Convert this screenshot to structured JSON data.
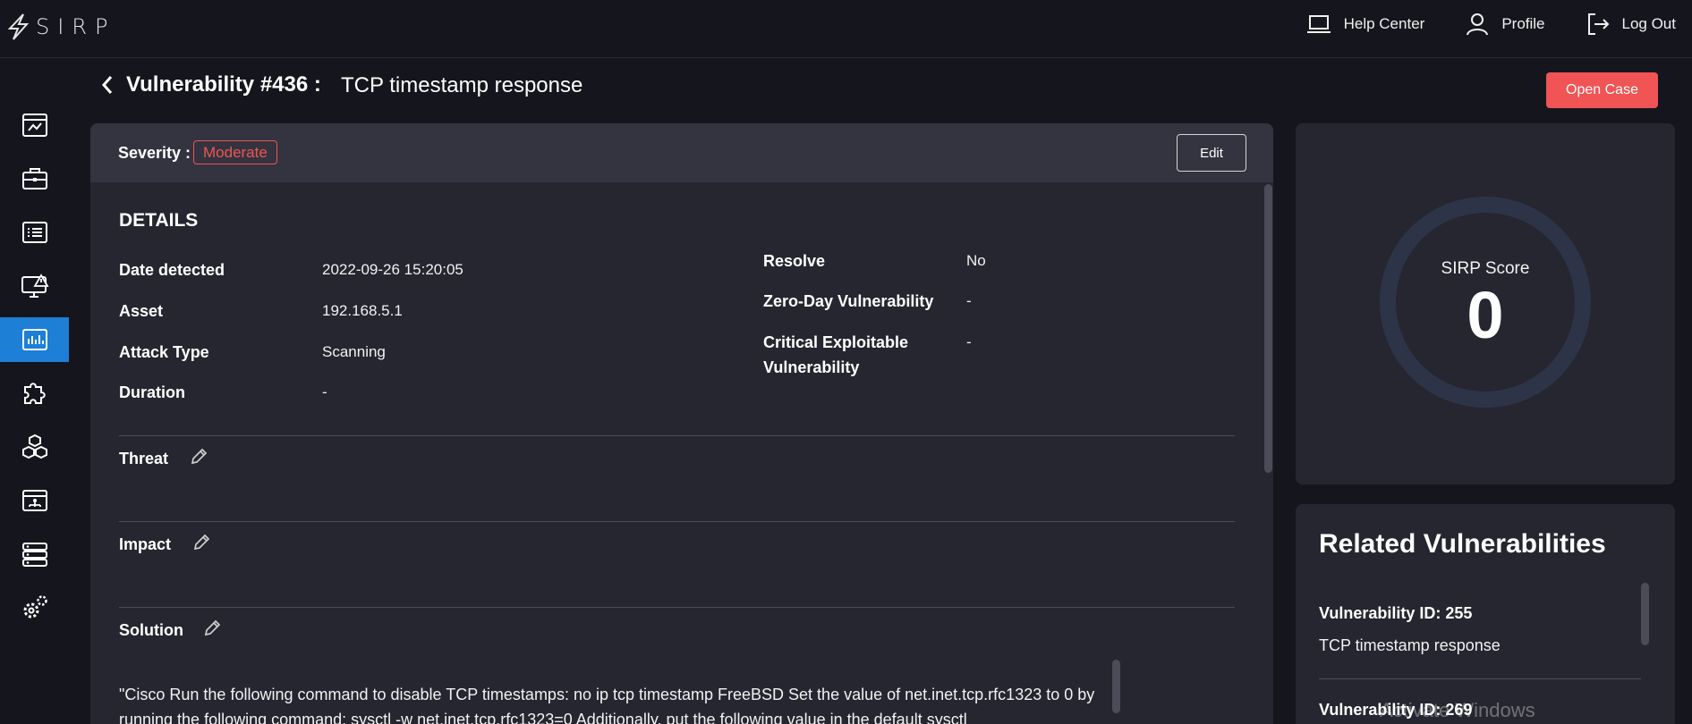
{
  "brand": {
    "name": "SIRP"
  },
  "topnav": [
    {
      "label": "Help Center",
      "icon": "laptop-icon"
    },
    {
      "label": "Profile",
      "icon": "user-icon"
    },
    {
      "label": "Log Out",
      "icon": "logout-icon"
    }
  ],
  "sidebar": {
    "items": [
      {
        "icon": "dashboard-icon"
      },
      {
        "icon": "briefcase-icon"
      },
      {
        "icon": "list-icon"
      },
      {
        "icon": "monitor-alert-icon"
      },
      {
        "icon": "vulnerability-chart-icon",
        "active": true
      },
      {
        "icon": "puzzle-icon"
      },
      {
        "icon": "cubes-icon"
      },
      {
        "icon": "network-icon"
      },
      {
        "icon": "database-icon"
      },
      {
        "icon": "settings-icon"
      }
    ],
    "active_color": "#1d7fd6"
  },
  "header": {
    "title": "Vulnerability #436 :",
    "subtitle": "TCP timestamp response",
    "open_case_label": "Open Case"
  },
  "card": {
    "severity_label": "Severity :",
    "severity_value": "Moderate",
    "severity_color": "#f05454",
    "edit_label": "Edit",
    "details_title": "DETAILS",
    "left_fields": [
      {
        "label": "Date detected",
        "value": "2022-09-26 15:20:05"
      },
      {
        "label": "Asset",
        "value": "192.168.5.1"
      },
      {
        "label": "Attack Type",
        "value": "Scanning"
      },
      {
        "label": "Duration",
        "value": "-"
      }
    ],
    "right_fields": [
      {
        "label": "Resolve",
        "value": "No"
      },
      {
        "label": "Zero-Day Vulnerability",
        "value": "-"
      },
      {
        "label": "Critical Exploitable Vulnerability",
        "value": "-"
      }
    ],
    "sections": {
      "threat": "Threat",
      "impact": "Impact",
      "solution": "Solution"
    },
    "solution_text": "\"Cisco Run the following command to disable TCP timestamps: no ip tcp timestamp FreeBSD Set the value of net.inet.tcp.rfc1323 to 0 by running the following command: sysctl -w net.inet.tcp.rfc1323=0 Additionally, put the following value in the default sysctl"
  },
  "score": {
    "label": "SIRP Score",
    "value": "0"
  },
  "related": {
    "title": "Related Vulnerabilities",
    "items": [
      {
        "id_label": "Vulnerability ID: 255",
        "name": "TCP timestamp response"
      },
      {
        "id_label": "Vulnerability ID: 269"
      }
    ]
  },
  "watermark": "Activate Windows",
  "accent": "#f05454"
}
